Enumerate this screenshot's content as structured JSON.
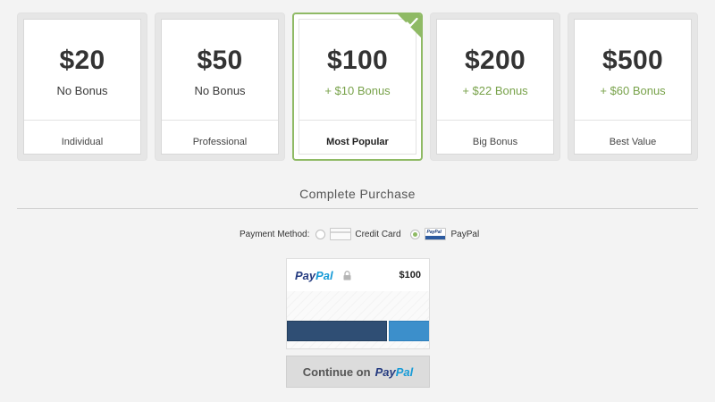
{
  "plans": [
    {
      "price": "$20",
      "bonus": "No Bonus",
      "tier": "Individual"
    },
    {
      "price": "$50",
      "bonus": "No Bonus",
      "tier": "Professional"
    },
    {
      "price": "$100",
      "bonus": "+ $10 Bonus",
      "tier": "Most Popular",
      "selected": true
    },
    {
      "price": "$200",
      "bonus": "+ $22 Bonus",
      "tier": "Big Bonus"
    },
    {
      "price": "$500",
      "bonus": "+ $60 Bonus",
      "tier": "Best Value"
    }
  ],
  "selected_icon": "checkmark-icon",
  "purchase": {
    "title": "Complete Purchase",
    "payment_label": "Payment Method:",
    "methods": [
      {
        "label": "Credit Card",
        "icon": "credit-card-icon",
        "checked": false
      },
      {
        "label": "PayPal",
        "icon": "paypal-icon",
        "checked": true
      }
    ]
  },
  "paypal_box": {
    "logo_pay": "Pay",
    "logo_pal": "Pal",
    "lock_icon": "lock-icon",
    "amount": "$100"
  },
  "continue": {
    "prefix": "Continue on",
    "brand_pay": "Pay",
    "brand_pal": "Pal"
  },
  "colors": {
    "accent_green": "#8fba65",
    "bonus_green": "#78a24a",
    "paypal_dark_blue": "#253b80",
    "paypal_light_blue": "#179bd7"
  }
}
